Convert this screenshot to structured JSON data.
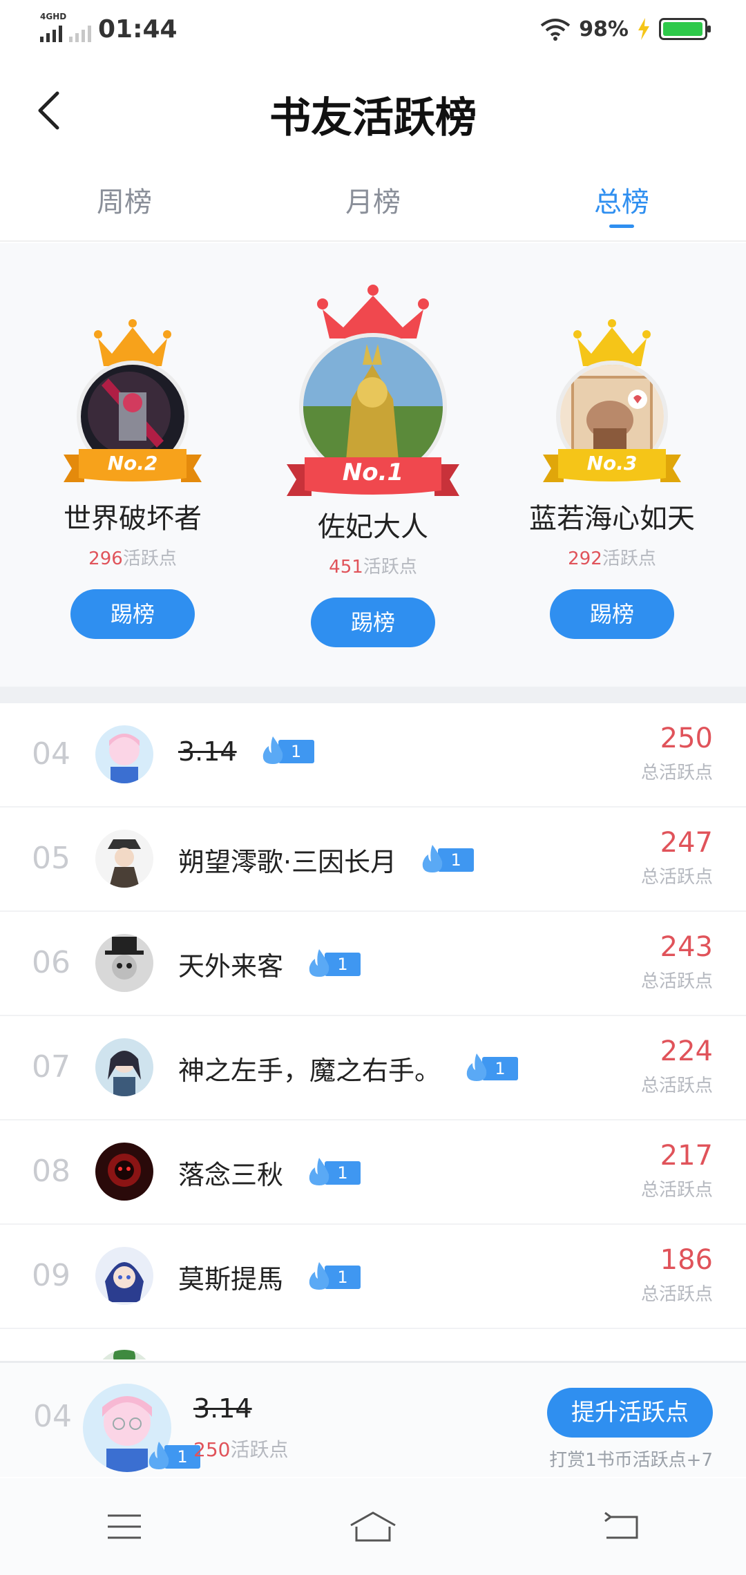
{
  "status_bar": {
    "network": "4GHD",
    "time": "01:44",
    "battery": "98%"
  },
  "header": {
    "title": "书友活跃榜"
  },
  "tabs": [
    {
      "label": "周榜",
      "active": false
    },
    {
      "label": "月榜",
      "active": false
    },
    {
      "label": "总榜",
      "active": true
    }
  ],
  "podium": [
    {
      "rank": "No.2",
      "name": "世界破坏者",
      "points": "296",
      "points_unit": "活跃点",
      "button": "踢榜"
    },
    {
      "rank": "No.1",
      "name": "佐妃大人",
      "points": "451",
      "points_unit": "活跃点",
      "button": "踢榜"
    },
    {
      "rank": "No.3",
      "name": "蓝若海心如天",
      "points": "292",
      "points_unit": "活跃点",
      "button": "踢榜"
    }
  ],
  "list": [
    {
      "rank": "04",
      "name": "3.14",
      "level": "1",
      "score": "250",
      "score_label": "总活跃点"
    },
    {
      "rank": "05",
      "name": "朔望澪歌·三因长月",
      "level": "1",
      "score": "247",
      "score_label": "总活跃点"
    },
    {
      "rank": "06",
      "name": "天外来客",
      "level": "1",
      "score": "243",
      "score_label": "总活跃点"
    },
    {
      "rank": "07",
      "name": "神之左手，魔之右手。",
      "level": "1",
      "score": "224",
      "score_label": "总活跃点"
    },
    {
      "rank": "08",
      "name": "落念三秋",
      "level": "1",
      "score": "217",
      "score_label": "总活跃点"
    },
    {
      "rank": "09",
      "name": "莫斯提馬",
      "level": "1",
      "score": "186",
      "score_label": "总活跃点"
    }
  ],
  "my_rank": {
    "rank": "04",
    "name": "3.14",
    "level": "1",
    "points": "250",
    "points_unit": "活跃点",
    "button": "提升活跃点",
    "hint": "打赏1书币活跃点+7"
  },
  "colors": {
    "accent": "#2f8ff0",
    "score": "#e0535a",
    "gold": "#f7a21b",
    "red_crown": "#f0484e"
  }
}
